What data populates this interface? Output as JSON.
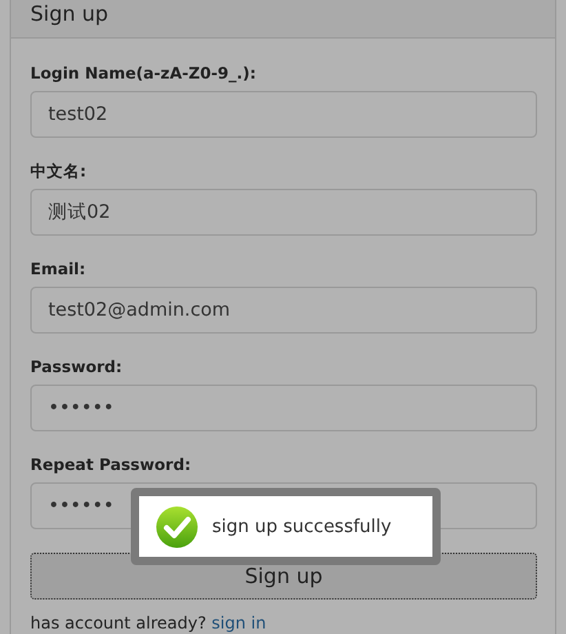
{
  "panel": {
    "title": "Sign up"
  },
  "fields": [
    {
      "label": "Login Name(a-zA-Z0-9_.):",
      "value": "test02"
    },
    {
      "label": "中文名:",
      "value": "测试02"
    },
    {
      "label": "Email:",
      "value": "test02@admin.com"
    },
    {
      "label": "Password:",
      "value": "••••••"
    },
    {
      "label": "Repeat Password:",
      "value": "••••••"
    }
  ],
  "submit_button": "Sign up",
  "footer": {
    "text": "has account already?",
    "link": "sign in"
  },
  "toast": {
    "message": "sign up successfully"
  }
}
